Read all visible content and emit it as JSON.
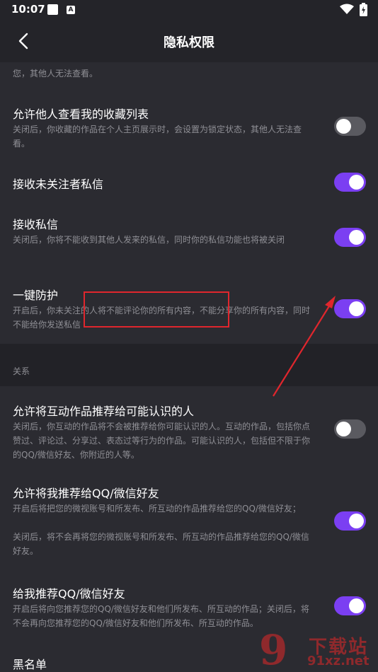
{
  "status_bar": {
    "time": "10:07",
    "notif_letter": "A"
  },
  "header": {
    "title": "隐私权限"
  },
  "partial_top_text": "您，其他人无法查看。",
  "settings_group1": [
    {
      "title": "允许他人查看我的收藏列表",
      "desc": "关闭后，你收藏的作品在个人主页展示时，会设置为锁定状态，其他人无法查看。",
      "on": false
    },
    {
      "title": "接收未关注者私信",
      "desc": "",
      "on": true
    },
    {
      "title": "接收私信",
      "desc": "关闭后，你将不能收到其他人发来的私信，同时你的私信功能也将被关闭",
      "on": true
    },
    {
      "title": "一键防护",
      "desc": "开启后，你未关注的人将不能评论你的所有内容，不能分享你的所有内容，同时不能给你发送私信",
      "on": true
    }
  ],
  "section_relations": {
    "label": "关系"
  },
  "settings_group2": [
    {
      "title": "允许将互动作品推荐给可能认识的人",
      "desc": "关闭后，你互动的作品将不会被推荐给你可能认识的人。互动的作品，包括你点赞过、评论过、分享过、表态过等行为的作品。可能认识的人，包括但不限于你的QQ/微信好友、你附近的人等。",
      "on": false
    },
    {
      "title": "允许将我推荐给QQ/微信好友",
      "desc1": "开启后将把您的微视账号和所发布、所互动的作品推荐给您的QQ/微信好友；",
      "desc2": "关闭后，将不会再将您的微视账号和所发布、所互动的作品推荐给您的QQ/微信好友。",
      "on": true
    },
    {
      "title": "给我推荐QQ/微信好友",
      "desc": "开启后将向您推荐您的QQ/微信好友和他们所发布、所互动的作品；关闭后，将不会再向您推荐您的QQ/微信好友和他们所发布、所互动的作品。",
      "on": true
    },
    {
      "title": "黑名单"
    }
  ],
  "watermark": {
    "chars": "下载站",
    "url": "91xz.net",
    "digit": "9"
  },
  "colors": {
    "accent": "#7b3ff2",
    "annotation": "#e0262d",
    "background": "#2b2b31"
  }
}
